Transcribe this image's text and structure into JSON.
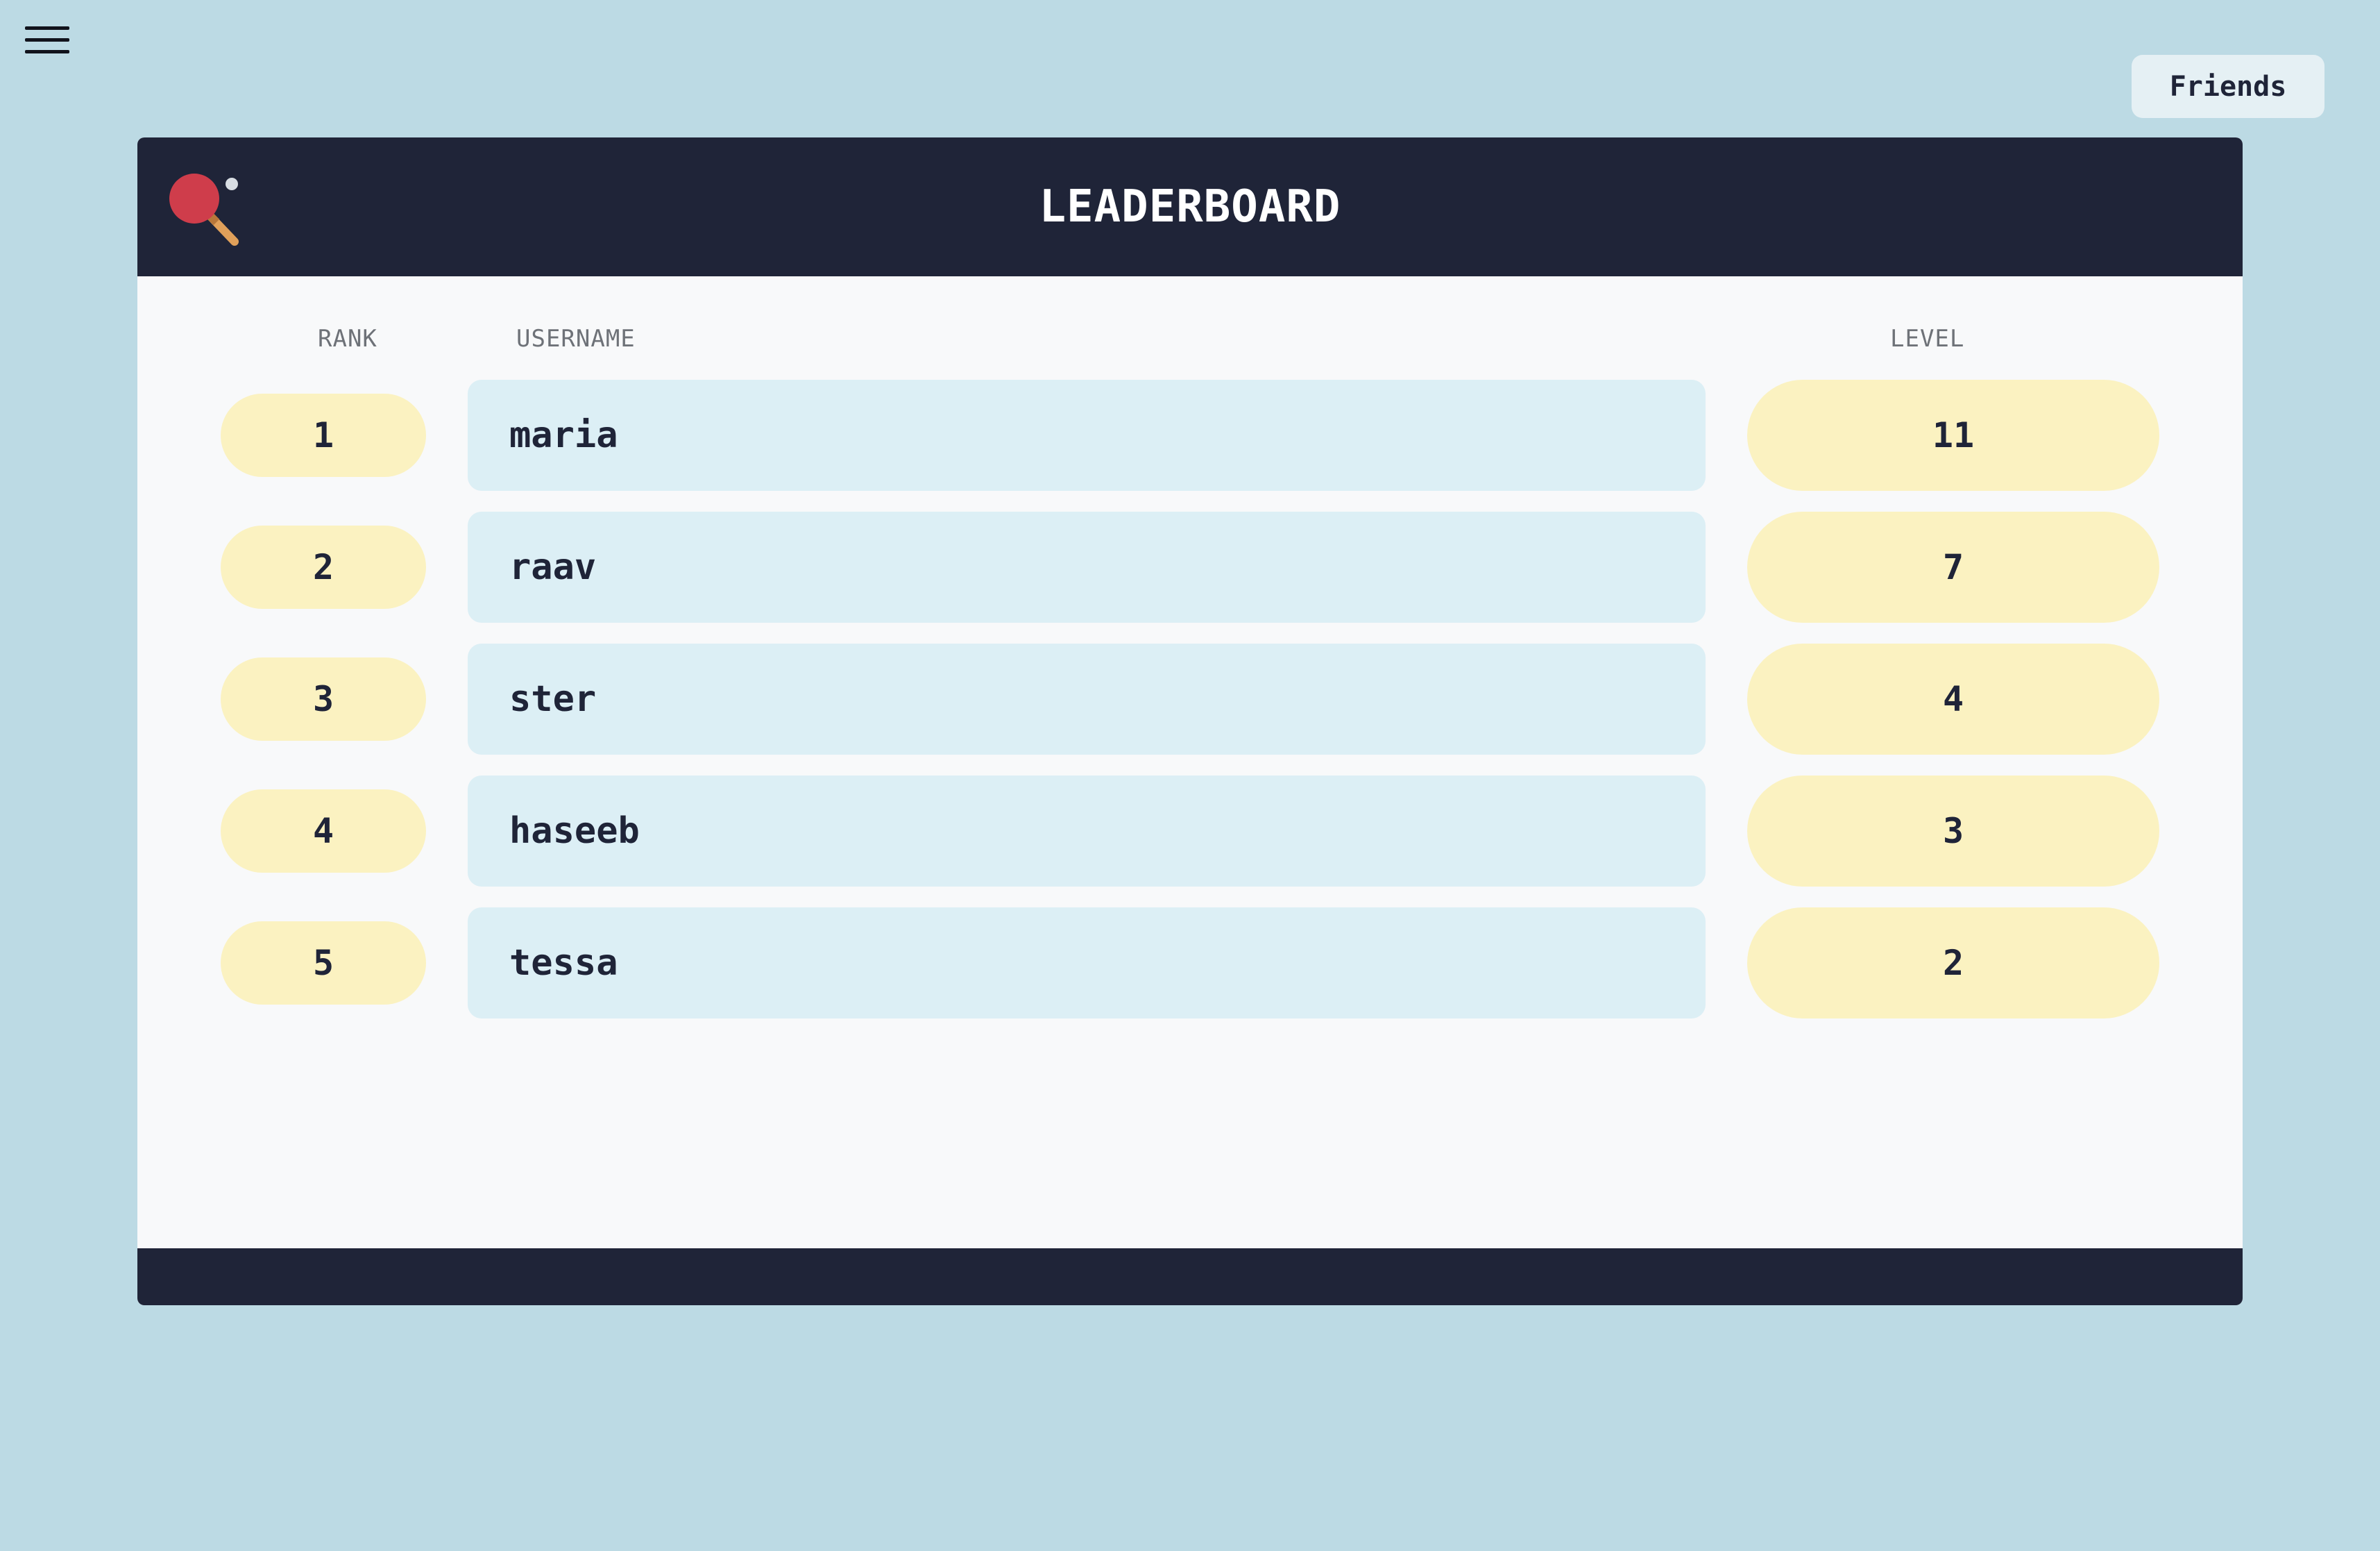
{
  "menu": {
    "icon": "hamburger-menu-icon"
  },
  "friends_button": {
    "label": "Friends"
  },
  "header": {
    "logo_icon": "ping-pong-paddle-icon",
    "title": "LEADERBOARD"
  },
  "table": {
    "columns": {
      "rank": "RANK",
      "username": "USERNAME",
      "level": "LEVEL"
    },
    "rows": [
      {
        "rank": "1",
        "username": "maria",
        "level": "11"
      },
      {
        "rank": "2",
        "username": "raav",
        "level": "7"
      },
      {
        "rank": "3",
        "username": "ster",
        "level": "4"
      },
      {
        "rank": "4",
        "username": "haseeb",
        "level": "3"
      },
      {
        "rank": "5",
        "username": "tessa",
        "level": "2"
      }
    ]
  },
  "colors": {
    "background": "#bcdae4",
    "header_bg": "#1f2438",
    "panel_bg": "#f8f9fa",
    "rank_pill": "#fbf2c1",
    "username_box": "#dceff5",
    "paddle_red": "#cf3d4b",
    "paddle_handle": "#e0a05a"
  }
}
